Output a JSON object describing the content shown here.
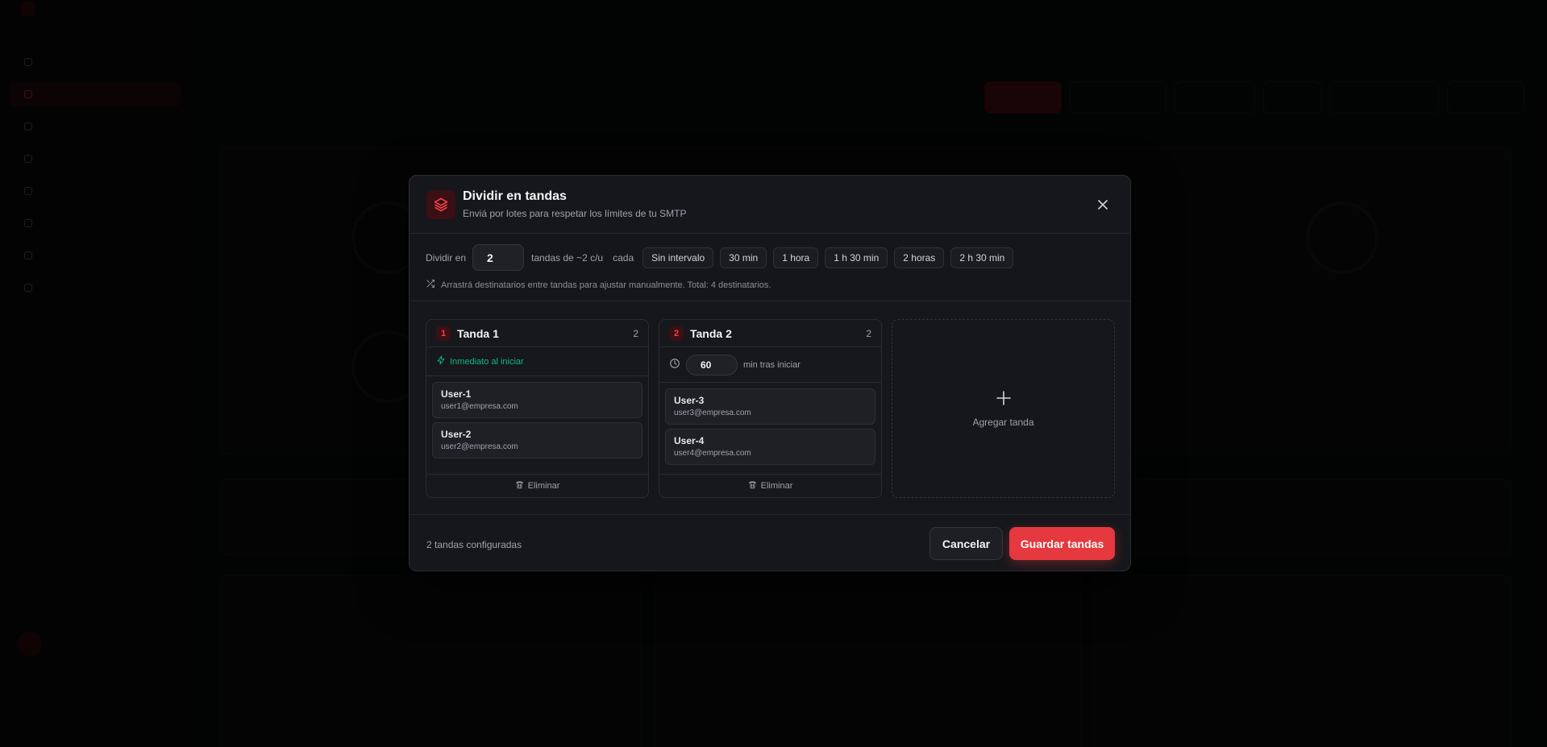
{
  "modal": {
    "title": "Dividir en tandas",
    "subtitle": "Enviá por lotes para respetar los límites de tu SMTP",
    "controls": {
      "split_label": "Dividir en",
      "split_value": "2",
      "per_batch_label": "tandas de ~2 c/u",
      "every_label": "cada",
      "intervals": [
        "Sin intervalo",
        "30 min",
        "1 hora",
        "1 h 30 min",
        "2 horas",
        "2 h 30 min"
      ],
      "hint": "Arrastrá destinatarios entre tandas para ajustar manualmente. Total: 4 destinatarios."
    },
    "batches": [
      {
        "number": "1",
        "name": "Tanda 1",
        "count": "2",
        "timing": "Inmediato al iniciar",
        "recipients": [
          {
            "name": "User-1",
            "email": "user1@empresa.com"
          },
          {
            "name": "User-2",
            "email": "user2@empresa.com"
          }
        ],
        "delete_label": "Eliminar"
      },
      {
        "number": "2",
        "name": "Tanda 2",
        "count": "2",
        "delay_value": "60",
        "delay_label": "min tras iniciar",
        "recipients": [
          {
            "name": "User-3",
            "email": "user3@empresa.com"
          },
          {
            "name": "User-4",
            "email": "user4@empresa.com"
          }
        ],
        "delete_label": "Eliminar"
      }
    ],
    "add_batch_label": "Agregar tanda",
    "footer": {
      "summary": "2 tandas configuradas",
      "cancel_label": "Cancelar",
      "save_label": "Guardar tandas"
    }
  },
  "colors": {
    "accent": "#e5383f",
    "success": "#10b981",
    "modal_bg": "#16171b",
    "page_bg": "#0a0b0d"
  }
}
